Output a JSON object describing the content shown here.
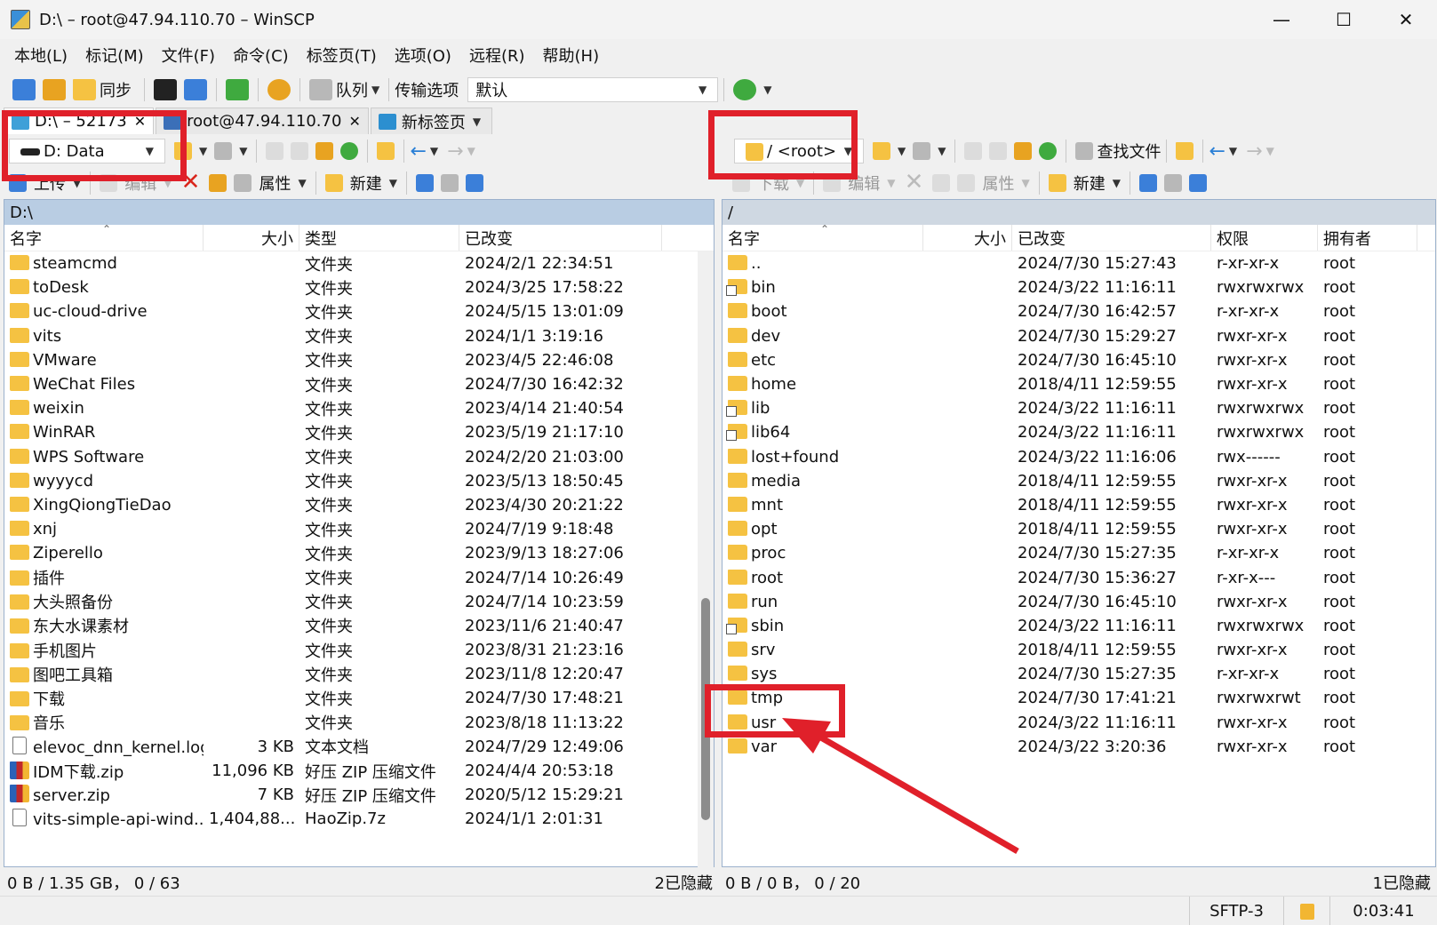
{
  "window": {
    "title": "D:\\ – root@47.94.110.70 – WinSCP",
    "min": "—",
    "max": "☐",
    "close": "✕"
  },
  "menu": [
    "本地(L)",
    "标记(M)",
    "文件(F)",
    "命令(C)",
    "标签页(T)",
    "选项(O)",
    "远程(R)",
    "帮助(H)"
  ],
  "toolbar": {
    "sync_label": "同步",
    "queue_label": "队列",
    "transfer_label": "传输选项",
    "transfer_value": "默认"
  },
  "tabs": [
    {
      "label": "D:\\ – 52173"
    },
    {
      "label": "root@47.94.110.70"
    },
    {
      "label": "新标签页"
    }
  ],
  "local": {
    "drive": "D: Data",
    "actions": {
      "upload": "上传",
      "edit": "编辑",
      "props": "属性",
      "new": "新建"
    },
    "path": "D:\\",
    "columns": [
      "名字",
      "大小",
      "类型",
      "已改变"
    ],
    "rows": [
      {
        "name": "steamcmd",
        "size": "",
        "type": "文件夹",
        "changed": "2024/2/1 22:34:51",
        "icon": "folder"
      },
      {
        "name": "toDesk",
        "size": "",
        "type": "文件夹",
        "changed": "2024/3/25 17:58:22",
        "icon": "folder"
      },
      {
        "name": "uc-cloud-drive",
        "size": "",
        "type": "文件夹",
        "changed": "2024/5/15 13:01:09",
        "icon": "folder"
      },
      {
        "name": "vits",
        "size": "",
        "type": "文件夹",
        "changed": "2024/1/1 3:19:16",
        "icon": "folder"
      },
      {
        "name": "VMware",
        "size": "",
        "type": "文件夹",
        "changed": "2023/4/5 22:46:08",
        "icon": "folder"
      },
      {
        "name": "WeChat Files",
        "size": "",
        "type": "文件夹",
        "changed": "2024/7/30 16:42:32",
        "icon": "folder"
      },
      {
        "name": "weixin",
        "size": "",
        "type": "文件夹",
        "changed": "2023/4/14 21:40:54",
        "icon": "folder"
      },
      {
        "name": "WinRAR",
        "size": "",
        "type": "文件夹",
        "changed": "2023/5/19 21:17:10",
        "icon": "folder"
      },
      {
        "name": "WPS Software",
        "size": "",
        "type": "文件夹",
        "changed": "2024/2/20 21:03:00",
        "icon": "folder"
      },
      {
        "name": "wyyycd",
        "size": "",
        "type": "文件夹",
        "changed": "2023/5/13 18:50:45",
        "icon": "folder"
      },
      {
        "name": "XingQiongTieDao",
        "size": "",
        "type": "文件夹",
        "changed": "2023/4/30 20:21:22",
        "icon": "folder"
      },
      {
        "name": "xnj",
        "size": "",
        "type": "文件夹",
        "changed": "2024/7/19 9:18:48",
        "icon": "folder"
      },
      {
        "name": "Ziperello",
        "size": "",
        "type": "文件夹",
        "changed": "2023/9/13 18:27:06",
        "icon": "folder"
      },
      {
        "name": "插件",
        "size": "",
        "type": "文件夹",
        "changed": "2024/7/14 10:26:49",
        "icon": "folder"
      },
      {
        "name": "大头照备份",
        "size": "",
        "type": "文件夹",
        "changed": "2024/7/14 10:23:59",
        "icon": "folder"
      },
      {
        "name": "东大水课素材",
        "size": "",
        "type": "文件夹",
        "changed": "2023/11/6 21:40:47",
        "icon": "folder"
      },
      {
        "name": "手机图片",
        "size": "",
        "type": "文件夹",
        "changed": "2023/8/31 21:23:16",
        "icon": "folder"
      },
      {
        "name": "图吧工具箱",
        "size": "",
        "type": "文件夹",
        "changed": "2023/11/8 12:20:47",
        "icon": "folder"
      },
      {
        "name": "下载",
        "size": "",
        "type": "文件夹",
        "changed": "2024/7/30 17:48:21",
        "icon": "folder"
      },
      {
        "name": "音乐",
        "size": "",
        "type": "文件夹",
        "changed": "2023/8/18 11:13:22",
        "icon": "folder"
      },
      {
        "name": "elevoc_dnn_kernel.log",
        "size": "3 KB",
        "type": "文本文档",
        "changed": "2024/7/29 12:49:06",
        "icon": "file"
      },
      {
        "name": "IDM下载.zip",
        "size": "11,096 KB",
        "type": "好压 ZIP 压缩文件",
        "changed": "2024/4/4 20:53:18",
        "icon": "zip"
      },
      {
        "name": "server.zip",
        "size": "7 KB",
        "type": "好压 ZIP 压缩文件",
        "changed": "2020/5/12 15:29:21",
        "icon": "zip"
      },
      {
        "name": "vits-simple-api-wind...",
        "size": "1,404,88...",
        "type": "HaoZip.7z",
        "changed": "2024/1/1 2:01:31",
        "icon": "file"
      }
    ],
    "status": "0 B / 1.35 GB，  0 / 63",
    "hidden": "2已隐藏"
  },
  "remote": {
    "dir": "/ <root>",
    "find_label": "查找文件",
    "actions": {
      "download": "下载",
      "edit": "编辑",
      "props": "属性",
      "new": "新建"
    },
    "path": "/",
    "columns": [
      "名字",
      "大小",
      "已改变",
      "权限",
      "拥有者"
    ],
    "rows": [
      {
        "name": "..",
        "changed": "2024/7/30 15:27:43",
        "perm": "r-xr-xr-x",
        "owner": "root",
        "icon": "up"
      },
      {
        "name": "bin",
        "changed": "2024/3/22 11:16:11",
        "perm": "rwxrwxrwx",
        "owner": "root",
        "icon": "link"
      },
      {
        "name": "boot",
        "changed": "2024/7/30 16:42:57",
        "perm": "r-xr-xr-x",
        "owner": "root",
        "icon": "folder"
      },
      {
        "name": "dev",
        "changed": "2024/7/30 15:29:27",
        "perm": "rwxr-xr-x",
        "owner": "root",
        "icon": "folder"
      },
      {
        "name": "etc",
        "changed": "2024/7/30 16:45:10",
        "perm": "rwxr-xr-x",
        "owner": "root",
        "icon": "folder"
      },
      {
        "name": "home",
        "changed": "2018/4/11 12:59:55",
        "perm": "rwxr-xr-x",
        "owner": "root",
        "icon": "folder"
      },
      {
        "name": "lib",
        "changed": "2024/3/22 11:16:11",
        "perm": "rwxrwxrwx",
        "owner": "root",
        "icon": "link"
      },
      {
        "name": "lib64",
        "changed": "2024/3/22 11:16:11",
        "perm": "rwxrwxrwx",
        "owner": "root",
        "icon": "link"
      },
      {
        "name": "lost+found",
        "changed": "2024/3/22 11:16:06",
        "perm": "rwx------",
        "owner": "root",
        "icon": "folder"
      },
      {
        "name": "media",
        "changed": "2018/4/11 12:59:55",
        "perm": "rwxr-xr-x",
        "owner": "root",
        "icon": "folder"
      },
      {
        "name": "mnt",
        "changed": "2018/4/11 12:59:55",
        "perm": "rwxr-xr-x",
        "owner": "root",
        "icon": "folder"
      },
      {
        "name": "opt",
        "changed": "2018/4/11 12:59:55",
        "perm": "rwxr-xr-x",
        "owner": "root",
        "icon": "folder"
      },
      {
        "name": "proc",
        "changed": "2024/7/30 15:27:35",
        "perm": "r-xr-xr-x",
        "owner": "root",
        "icon": "folder"
      },
      {
        "name": "root",
        "changed": "2024/7/30 15:36:27",
        "perm": "r-xr-x---",
        "owner": "root",
        "icon": "folder"
      },
      {
        "name": "run",
        "changed": "2024/7/30 16:45:10",
        "perm": "rwxr-xr-x",
        "owner": "root",
        "icon": "folder"
      },
      {
        "name": "sbin",
        "changed": "2024/3/22 11:16:11",
        "perm": "rwxrwxrwx",
        "owner": "root",
        "icon": "link"
      },
      {
        "name": "srv",
        "changed": "2018/4/11 12:59:55",
        "perm": "rwxr-xr-x",
        "owner": "root",
        "icon": "folder"
      },
      {
        "name": "sys",
        "changed": "2024/7/30 15:27:35",
        "perm": "r-xr-xr-x",
        "owner": "root",
        "icon": "folder"
      },
      {
        "name": "tmp",
        "changed": "2024/7/30 17:41:21",
        "perm": "rwxrwxrwt",
        "owner": "root",
        "icon": "folder"
      },
      {
        "name": "usr",
        "changed": "2024/3/22 11:16:11",
        "perm": "rwxr-xr-x",
        "owner": "root",
        "icon": "folder"
      },
      {
        "name": "var",
        "changed": "2024/3/22 3:20:36",
        "perm": "rwxr-xr-x",
        "owner": "root",
        "icon": "folder"
      }
    ],
    "status": "0 B / 0 B，  0 / 20",
    "hidden": "1已隐藏"
  },
  "bottom": {
    "protocol": "SFTP-3",
    "time": "0:03:41"
  },
  "annotation_color": "#e0202a"
}
